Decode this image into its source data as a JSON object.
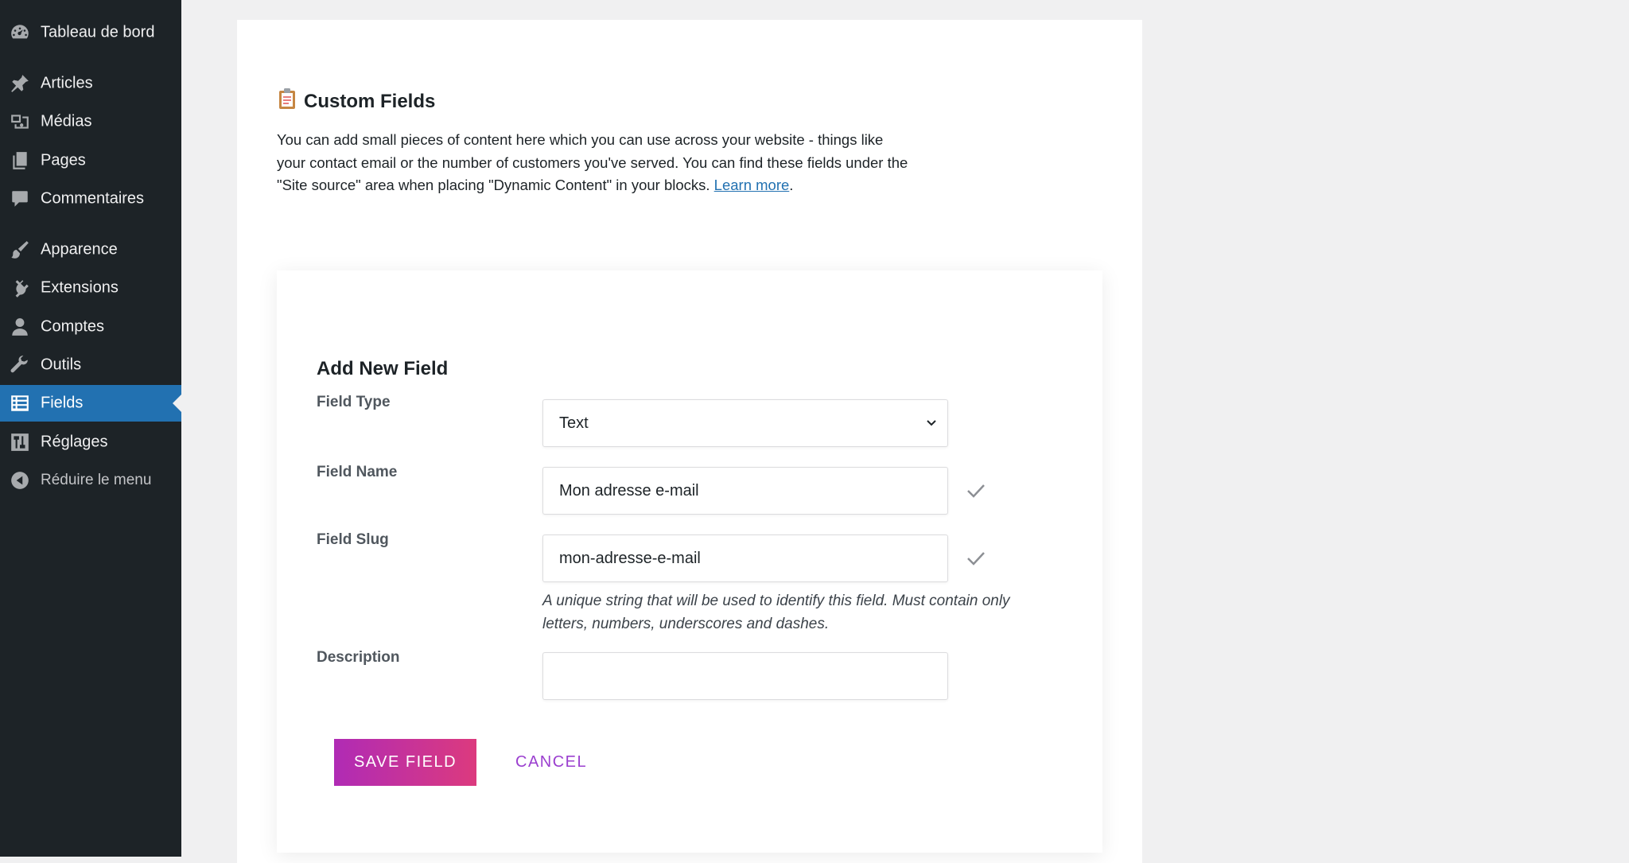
{
  "sidebar": {
    "items": [
      {
        "label": "Tableau de bord",
        "icon": "dashboard-icon"
      },
      {
        "label": "Articles",
        "icon": "pin-icon"
      },
      {
        "label": "Médias",
        "icon": "media-icon"
      },
      {
        "label": "Pages",
        "icon": "pages-icon"
      },
      {
        "label": "Commentaires",
        "icon": "comment-icon"
      },
      {
        "label": "Apparence",
        "icon": "brush-icon"
      },
      {
        "label": "Extensions",
        "icon": "plugin-icon"
      },
      {
        "label": "Comptes",
        "icon": "user-icon"
      },
      {
        "label": "Outils",
        "icon": "wrench-icon"
      },
      {
        "label": "Fields",
        "icon": "list-icon",
        "active": true
      },
      {
        "label": "Réglages",
        "icon": "settings-icon"
      },
      {
        "label": "Réduire le menu",
        "icon": "collapse-icon"
      }
    ]
  },
  "page": {
    "title": "Custom Fields",
    "title_icon": "clipboard-icon",
    "intro": "You can add small pieces of content here which you can use across your website - things like your contact email or the number of customers you've served. You can find these fields under the \"Site source\" area when placing \"Dynamic Content\" in your blocks. ",
    "learn_more": "Learn more",
    "intro_end": "."
  },
  "form": {
    "title": "Add New Field",
    "field_type_label": "Field Type",
    "field_type_value": "Text",
    "field_name_label": "Field Name",
    "field_name_value": "Mon adresse e-mail",
    "field_slug_label": "Field Slug",
    "field_slug_value": "mon-adresse-e-mail",
    "slug_help": "A unique string that will be used to identify this field. Must contain only letters, numbers, underscores and dashes.",
    "description_label": "Description",
    "description_value": "",
    "save_label": "SAVE FIELD",
    "cancel_label": "CANCEL"
  },
  "colors": {
    "sidebar_bg": "#1d2327",
    "active_item": "#2271b1",
    "save_gradient_start": "#b02bb5",
    "save_gradient_end": "#dc3a7e",
    "cancel_text": "#9b3fcf",
    "link": "#2271b1"
  }
}
